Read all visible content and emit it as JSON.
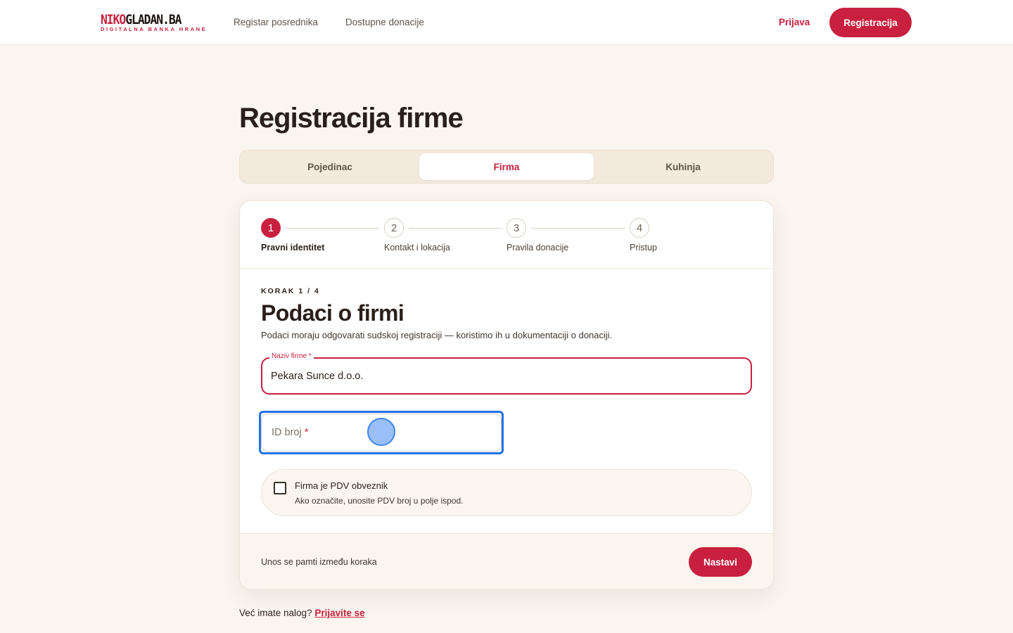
{
  "header": {
    "logo_part1": "NIKO",
    "logo_part2": "GLADAN.BA",
    "logo_tagline": "DIGITALNA BANKA HRANE",
    "nav": [
      "Registar posrednika",
      "Dostupne donacije"
    ],
    "login_label": "Prijava",
    "register_label": "Registracija"
  },
  "page": {
    "title": "Registracija firme"
  },
  "tabs": [
    {
      "label": "Pojedinac",
      "active": false
    },
    {
      "label": "Firma",
      "active": true
    },
    {
      "label": "Kuhinja",
      "active": false
    }
  ],
  "stepper": {
    "steps": [
      {
        "number": "1",
        "label": "Pravni identitet",
        "active": true
      },
      {
        "number": "2",
        "label": "Kontakt i lokacija",
        "active": false
      },
      {
        "number": "3",
        "label": "Pravila donacije",
        "active": false
      },
      {
        "number": "4",
        "label": "Pristup",
        "active": false
      }
    ]
  },
  "form": {
    "kicker": "KORAK 1 / 4",
    "title": "Podaci o firmi",
    "description": "Podaci moraju odgovarati sudskoj registraciji — koristimo ih u dokumentaciji o donaciji.",
    "company_name": {
      "label": "Naziv firme",
      "required_mark": "*",
      "value": "Pekara Sunce d.o.o."
    },
    "id_number": {
      "placeholder": "ID broj",
      "required_mark": "*",
      "value": ""
    },
    "pdv": {
      "title": "Firma je PDV obveznik",
      "hint": "Ako označite, unosite PDV broj u polje ispod.",
      "checked": false
    }
  },
  "footer": {
    "note": "Unos se pamti između koraka",
    "continue_label": "Nastavi"
  },
  "account": {
    "question": "Već imate nalog?",
    "link_label": "Prijavite se"
  },
  "colors": {
    "accent": "#c8203e",
    "background": "#faf5ef",
    "focus": "#1e73e8"
  }
}
